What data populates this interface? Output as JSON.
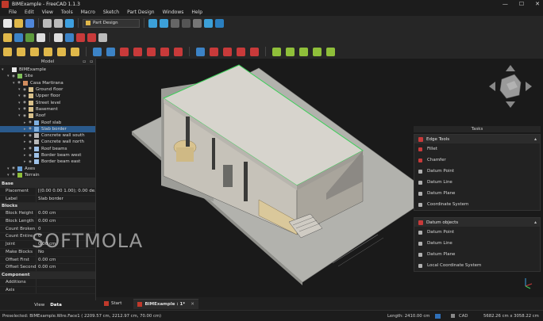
{
  "window": {
    "title": "BIMExample - FreeCAD 1.1.3",
    "controls": [
      "—",
      "☐",
      "✕"
    ]
  },
  "menu": [
    "File",
    "Edit",
    "View",
    "Tools",
    "Macro",
    "Sketch",
    "Part Design",
    "Windows",
    "Help"
  ],
  "workbench": {
    "selected": "Part Design"
  },
  "model_panel": {
    "title": "Model"
  },
  "tree": [
    {
      "label": "BIMExample",
      "depth": 0,
      "icon": "document-icon",
      "selected": false
    },
    {
      "label": "Site",
      "depth": 1,
      "icon": "site-icon",
      "selected": false
    },
    {
      "label": "Casa Martirana",
      "depth": 2,
      "icon": "building-icon",
      "selected": false
    },
    {
      "label": "Ground floor",
      "depth": 3,
      "icon": "floor-icon",
      "selected": false
    },
    {
      "label": "Upper floor",
      "depth": 3,
      "icon": "floor-icon",
      "selected": false
    },
    {
      "label": "Street level",
      "depth": 3,
      "icon": "floor-icon",
      "selected": false
    },
    {
      "label": "Basement",
      "depth": 3,
      "icon": "floor-icon",
      "selected": false
    },
    {
      "label": "Roof",
      "depth": 3,
      "icon": "floor-icon",
      "selected": false
    },
    {
      "label": "Roof slab",
      "depth": 4,
      "icon": "slab-icon",
      "selected": false
    },
    {
      "label": "Slab border",
      "depth": 4,
      "icon": "slab-icon",
      "selected": true
    },
    {
      "label": "Concrete wall south",
      "depth": 4,
      "icon": "wall-icon",
      "selected": false
    },
    {
      "label": "Concrete wall north",
      "depth": 4,
      "icon": "wall-icon",
      "selected": false
    },
    {
      "label": "Roof beams",
      "depth": 4,
      "icon": "beam-icon",
      "selected": false
    },
    {
      "label": "Border beam west",
      "depth": 4,
      "icon": "beam-icon",
      "selected": false
    },
    {
      "label": "Border beam east",
      "depth": 4,
      "icon": "beam-icon",
      "selected": false
    },
    {
      "label": "Axes",
      "depth": 1,
      "icon": "axes-icon",
      "selected": false
    },
    {
      "label": "Terrain",
      "depth": 1,
      "icon": "terrain-icon",
      "selected": false
    }
  ],
  "properties": [
    {
      "section": "Base",
      "rows": [
        {
          "key": "Placement",
          "value": "[(0.00 0.00 1.00); 0.00 de..."
        },
        {
          "key": "Label",
          "value": "Slab border"
        }
      ]
    },
    {
      "section": "Blocks",
      "rows": [
        {
          "key": "Block Height",
          "value": "0.00 cm"
        },
        {
          "key": "Block Length",
          "value": "0.00 cm"
        },
        {
          "key": "Count Broken",
          "value": "0"
        },
        {
          "key": "Count Entire",
          "value": "0"
        },
        {
          "key": "Joint",
          "value": "0.00 cm"
        },
        {
          "key": "Make Blocks",
          "value": "No"
        },
        {
          "key": "Offset First",
          "value": "0.00 cm"
        },
        {
          "key": "Offset Second",
          "value": "0.00 cm"
        }
      ]
    },
    {
      "section": "Component",
      "rows": [
        {
          "key": "Additions",
          "value": ""
        },
        {
          "key": "Axis",
          "value": ""
        }
      ]
    }
  ],
  "left_tabs": {
    "view": "View",
    "data": "Data"
  },
  "tasks": {
    "title": "Tasks",
    "groups": [
      {
        "title": "Edge Tools",
        "items": [
          "Fillet",
          "Chamfer",
          "Datum Point",
          "Datum Line",
          "Datum Plane",
          "Coordinate System"
        ]
      },
      {
        "title": "Datum objects",
        "items": [
          "Datum Point",
          "Datum Line",
          "Datum Plane",
          "Local Coordinate System"
        ]
      }
    ]
  },
  "doc_tabs": [
    {
      "label": "Start",
      "active": false
    },
    {
      "label": "BIMExample : 1*",
      "active": true
    }
  ],
  "status": {
    "preselected": "Preselected: BIMExample.Wire.Face1 ( 2209.57 cm, 2212.97 cm, 70.00 cm)",
    "length": "Length: 2410.00 cm",
    "nav": "CAD",
    "dims": "5682.26 cm x 3058.22 cm"
  },
  "watermark": "SOFTMOLA",
  "colors": {
    "selection": "#2a5a8c",
    "accent_green": "#3ecf5a",
    "wall": "#c7c3ba",
    "floor": "#b0b0ab",
    "wood": "#d9c79a"
  }
}
